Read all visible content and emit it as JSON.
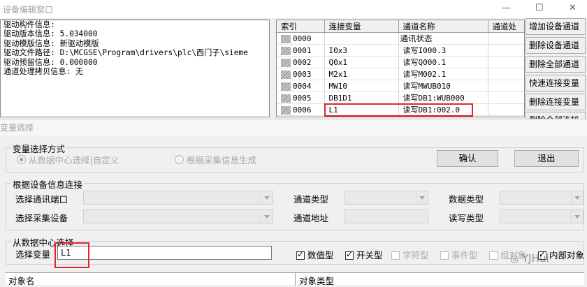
{
  "device_window": {
    "title": "设备编辑窗口",
    "info_lines": [
      "驱动构件信息:",
      "驱动版本信息: 5.034000",
      "驱动模版信息: 新驱动模版",
      "驱动文件路径: D:\\MCGSE\\Program\\drivers\\plc\\西门子\\sieme",
      "驱动预留信息: 0.000000",
      "通道处理拷贝信息: 无"
    ],
    "table": {
      "headers": [
        "索引",
        "连接变量",
        "通道名称",
        "通道处"
      ],
      "rows": [
        [
          "0000",
          "",
          "通讯状态"
        ],
        [
          "0001",
          "I0x3",
          "读写I000.3"
        ],
        [
          "0002",
          "Q0x1",
          "读写Q000.1"
        ],
        [
          "0003",
          "M2x1",
          "读写M002.1"
        ],
        [
          "0004",
          "MW10",
          "读写MWUB010"
        ],
        [
          "0005",
          "DB1D1",
          "读写DB1:WUB000"
        ],
        [
          "0006",
          "L1",
          "读写DB1:002.0"
        ]
      ]
    },
    "side_buttons": [
      "增加设备通道",
      "删除设备通道",
      "删除全部通道",
      "快速连接变量",
      "删除连接变量",
      "删除全部连接"
    ]
  },
  "dialog": {
    "title": "变量选择",
    "mode_group": {
      "label": "变量选择方式",
      "option_center": "从数据中心选择|自定义",
      "option_device": "根据采集信息生成"
    },
    "confirm_label": "确认",
    "exit_label": "退出",
    "device_group": {
      "label": "根据设备信息连接",
      "port_label": "选择通讯端口",
      "device_label": "选择采集设备",
      "channel_type_label": "通道类型",
      "channel_addr_label": "通道地址",
      "data_type_label": "数据类型",
      "rw_type_label": "读写类型"
    },
    "center_group": {
      "label": "从数据中心选择",
      "select_var_label": "选择变量",
      "select_var_value": "L1",
      "filters": [
        {
          "label": "数值型",
          "checked": true,
          "enabled": true
        },
        {
          "label": "开关型",
          "checked": true,
          "enabled": true
        },
        {
          "label": "字符型",
          "checked": false,
          "enabled": false
        },
        {
          "label": "事件型",
          "checked": false,
          "enabled": false
        },
        {
          "label": "组对象",
          "checked": false,
          "enabled": false
        },
        {
          "label": "内部对象",
          "checked": true,
          "enabled": true
        }
      ]
    },
    "columns": [
      "对象名",
      "对象类型"
    ]
  },
  "watermark": "YJHui",
  "colors": {
    "highlight": "#e0262a"
  }
}
